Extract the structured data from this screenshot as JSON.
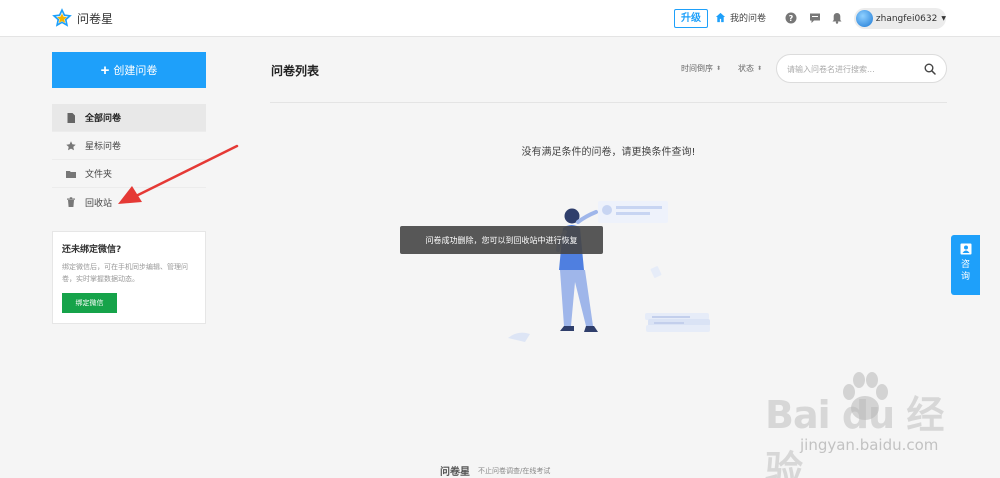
{
  "header": {
    "brand": "问卷星",
    "upgrade_label": "升级",
    "my_surveys_label": "我的问卷",
    "username": "zhangfei0632",
    "icons": [
      "star-logo-icon",
      "home-icon",
      "help-icon",
      "message-icon",
      "bell-icon",
      "avatar"
    ]
  },
  "sidebar": {
    "create_label": "创建问卷",
    "items": [
      {
        "label": "全部问卷",
        "icon": "document-icon",
        "active": true
      },
      {
        "label": "星标问卷",
        "icon": "star-icon",
        "active": false
      },
      {
        "label": "文件夹",
        "icon": "folder-icon",
        "active": false
      },
      {
        "label": "回收站",
        "icon": "trash-icon",
        "active": false
      }
    ],
    "wechat": {
      "title": "还未绑定微信?",
      "description": "绑定微信后，可在手机同步编辑、管理问卷，实时掌握数据动态。",
      "button_label": "绑定微信"
    }
  },
  "main": {
    "title": "问卷列表",
    "sort_time_label": "时间倒序",
    "sort_status_label": "状态",
    "search_placeholder": "请输入问卷名进行搜索...",
    "search_value": "",
    "empty_message": "没有满足条件的问卷，请更换条件查询!"
  },
  "toast": {
    "message": "问卷成功删除，您可以到回收站中进行恢复"
  },
  "consult": {
    "label": "咨询"
  },
  "footer": {
    "brand": "问卷星",
    "slogan": "不止问卷调查/在线考试"
  },
  "watermark": {
    "main": "Bai du 经验",
    "sub": "jingyan.baidu.com"
  },
  "colors": {
    "accent": "#1ea0fa",
    "wechat_green": "#16a34a",
    "annotation_arrow": "#e53935"
  }
}
